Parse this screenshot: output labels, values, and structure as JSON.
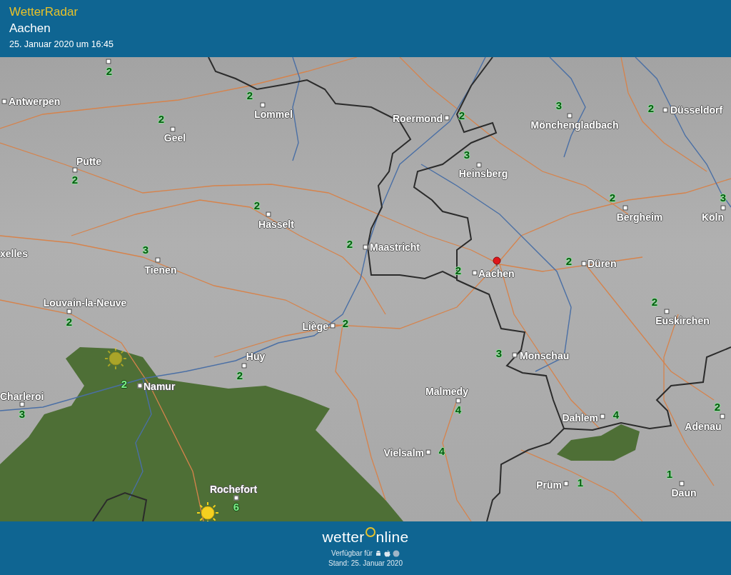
{
  "header": {
    "title": "WetterRadar",
    "location": "Aachen",
    "timestamp": "25. Januar 2020 um 16:45"
  },
  "map": {
    "places": [
      {
        "value": "2"
      },
      {
        "name": "Antwerpen"
      },
      {
        "name": "Lommel",
        "value": "2"
      },
      {
        "name": "Roermond",
        "value": "2"
      },
      {
        "name": "Mönchengladbach",
        "value": "3"
      },
      {
        "name": "Düsseldorf",
        "value": "2"
      },
      {
        "name": "Geel",
        "value": "2"
      },
      {
        "name": "Putte",
        "value": "2"
      },
      {
        "name": "Heinsberg",
        "value": "3"
      },
      {
        "name": "Hasselt",
        "value": "2"
      },
      {
        "name": "Bergheim",
        "value": "2"
      },
      {
        "name": "Köln",
        "value": "3"
      },
      {
        "name": "Maastricht",
        "value": "2"
      },
      {
        "name": "xelles"
      },
      {
        "name": "Tienen",
        "value": "3"
      },
      {
        "name": "Aachen",
        "value": "2"
      },
      {
        "name": "Düren",
        "value": "2"
      },
      {
        "name": "Louvain-la-Neuve",
        "value": "2"
      },
      {
        "name": "Euskirchen",
        "value": "2"
      },
      {
        "name": "Liège",
        "value": "2"
      },
      {
        "name": "Huy",
        "value": "2"
      },
      {
        "name": "Monschau",
        "value": "3"
      },
      {
        "name": "Namur",
        "value": "2"
      },
      {
        "name": "Charleroi",
        "value": "3"
      },
      {
        "name": "Malmedy",
        "value": "4"
      },
      {
        "name": "Dahlem",
        "value": "4"
      },
      {
        "name": "Adenau",
        "value": "2"
      },
      {
        "name": "Vielsalm",
        "value": "4"
      },
      {
        "name": "Prüm",
        "value": "1"
      },
      {
        "name": "Daun",
        "value": "1"
      },
      {
        "name": "Rochefort",
        "value": "6"
      }
    ]
  },
  "footer": {
    "logo": "wetteronline",
    "availability": "Verfügbar für",
    "updated": "Stand: 25. Januar 2020"
  }
}
